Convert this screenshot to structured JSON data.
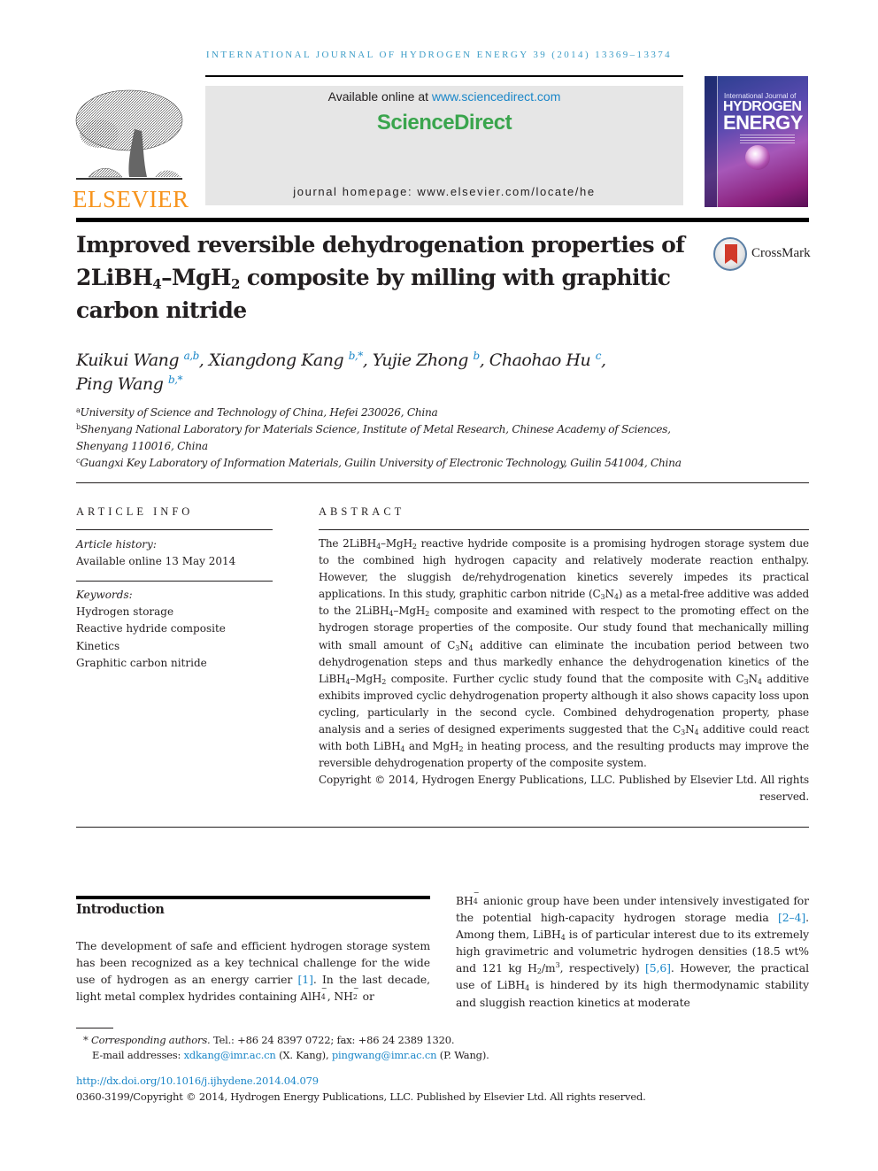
{
  "header": {
    "running_head": "INTERNATIONAL JOURNAL OF HYDROGEN ENERGY 39 (2014) 13369–13374",
    "publisher_logo_text": "ELSEVIER",
    "available_online_prefix": "Available online at ",
    "available_online_link": "www.sciencedirect.com",
    "sciencedirect_brand": "ScienceDirect",
    "journal_homepage": "journal homepage: www.elsevier.com/locate/he",
    "cover": {
      "line1": "International Journal of",
      "line2": "HYDROGEN",
      "line3": "ENERGY"
    },
    "colors": {
      "link_blue": "#1a86c8",
      "running_head": "#3d9dc7",
      "sciencedirect_green": "#3aa54d",
      "elsevier_orange": "#f7941d"
    }
  },
  "article": {
    "title_parts": {
      "l1": "Improved reversible dehydrogenation properties of",
      "l2a": "2LiBH",
      "l2b": "4",
      "l2c": "–MgH",
      "l2d": "2",
      "l2e": " composite by milling with graphitic",
      "l3": "carbon nitride"
    },
    "crossmark_label": "CrossMark",
    "authors": [
      {
        "name": "Kuikui Wang",
        "sup": "a,b",
        "sep": ", "
      },
      {
        "name": "Xiangdong Kang",
        "sup": "b,*",
        "sep": ", "
      },
      {
        "name": "Yujie Zhong",
        "sup": "b",
        "sep": ", "
      },
      {
        "name": "Chaohao Hu",
        "sup": "c",
        "sep": ","
      },
      {
        "name": "Ping Wang",
        "sup": "b,*",
        "sep": ""
      }
    ],
    "affiliations": [
      {
        "mark": "a",
        "text": "University of Science and Technology of China, Hefei 230026, China"
      },
      {
        "mark": "b",
        "text": "Shenyang National Laboratory for Materials Science, Institute of Metal Research, Chinese Academy of Sciences,",
        "text2": "Shenyang 110016, China"
      },
      {
        "mark": "c",
        "text": "Guangxi Key Laboratory of Information Materials, Guilin University of Electronic Technology, Guilin 541004, China"
      }
    ]
  },
  "article_info": {
    "heading": "ARTICLE INFO",
    "history_label": "Article history:",
    "history_value": "Available online 13 May 2014",
    "keywords_label": "Keywords:",
    "keywords": [
      "Hydrogen storage",
      "Reactive hydride composite",
      "Kinetics",
      "Graphitic carbon nitride"
    ]
  },
  "abstract": {
    "heading": "ABSTRACT",
    "t": {
      "s1": "The 2LiBH",
      "s2": "–MgH",
      "s3": " reactive hydride composite is a promising hydrogen storage system due to the combined high hydrogen capacity and relatively moderate reaction enthalpy. However, the sluggish de/rehydrogenation kinetics severely impedes its practical applications. In this study, graphitic carbon nitride (C",
      "s4": "N",
      "s5": ") as a metal-free additive was added to the 2LiBH",
      "s6": "–MgH",
      "s7": " composite and examined with respect to the promoting effect on the hydrogen storage properties of the composite. Our study found that mechanically milling with small amount of C",
      "s8": "N",
      "s9": " additive can eliminate the incubation period between two dehydrogenation steps and thus markedly enhance the dehydrogenation kinetics of the LiBH",
      "s10": "–MgH",
      "s11": " composite. Further cyclic study found that the composite with C",
      "s12": "N",
      "s13": " additive exhibits improved cyclic dehydrogenation property although it also shows capacity loss upon cycling, particularly in the second cycle. Combined dehydrogenation property, phase analysis and a series of designed experiments suggested that the C",
      "s14": "N",
      "s15": " additive could react with both LiBH",
      "s16": " and MgH",
      "s17": " in heating process, and the resulting products may improve the reversible dehydrogenation property of the composite system.",
      "n2": "2",
      "n3": "3",
      "n4": "4"
    },
    "copyright": "Copyright © 2014, Hydrogen Energy Publications, LLC. Published by Elsevier Ltd. All rights reserved."
  },
  "introduction": {
    "heading": "Introduction",
    "left": {
      "a": "The development of safe and efficient hydrogen storage system has been recognized as a key technical challenge for the wide use of hydrogen as an energy carrier ",
      "ref1": "[1]",
      "b": ". In the last decade, light metal complex hydrides containing AlH",
      "c": ", NH",
      "d": " or"
    },
    "right": {
      "a": "BH",
      "b": " anionic group have been under intensively investigated for the potential high-capacity hydrogen storage media ",
      "ref1": "[2–4]",
      "c": ". Among them, LiBH",
      "d": " is of particular interest due to its extremely high gravimetric and volumetric hydrogen densities (18.5 wt% and 121 kg H",
      "e": "/m",
      "f": ", respectively) ",
      "ref2": "[5,6]",
      "g": ". However, the practical use of LiBH",
      "h": " is hindered by its high thermodynamic stability and sluggish reaction kinetics at moderate"
    },
    "minus": "−"
  },
  "footnotes": {
    "star": "*",
    "corr_label": "Corresponding authors.",
    "corr_text": " Tel.: +86 24 8397 0722; fax: +86 24 2389 1320.",
    "email_label": "E-mail addresses: ",
    "email1": "xdkang@imr.ac.cn",
    "email1_who": " (X. Kang), ",
    "email2": "pingwang@imr.ac.cn",
    "email2_who": " (P. Wang).",
    "doi": "http://dx.doi.org/10.1016/j.ijhydene.2014.04.079",
    "issn": "0360-3199/Copyright © 2014, Hydrogen Energy Publications, LLC. Published by Elsevier Ltd. All rights reserved."
  }
}
